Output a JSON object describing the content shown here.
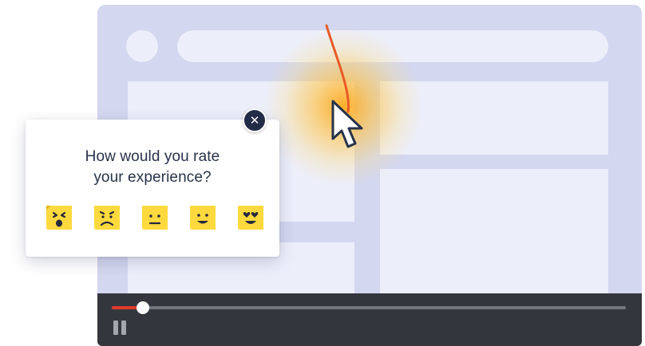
{
  "survey": {
    "question": "How would you rate\nyour experience?",
    "close_symbol": "✕",
    "ratings": [
      {
        "name": "angry",
        "icon": "angry-face-icon"
      },
      {
        "name": "sad",
        "icon": "sad-face-icon"
      },
      {
        "name": "neutral",
        "icon": "neutral-face-icon"
      },
      {
        "name": "happy",
        "icon": "happy-face-icon"
      },
      {
        "name": "love",
        "icon": "heart-eyes-face-icon"
      }
    ],
    "face_color": "#ffd93d"
  },
  "player": {
    "progress": 0.06,
    "fill_color": "#e0392b",
    "state_icon": "pause-icon"
  },
  "theme": {
    "browser_bg": "#d3d7ef",
    "block_color": "#eceefa",
    "controls_bg": "#33373d",
    "close_bg": "#222b48",
    "text_color": "#27324a",
    "trail_color": "#e85a26",
    "glow_color": "#ffb020"
  }
}
